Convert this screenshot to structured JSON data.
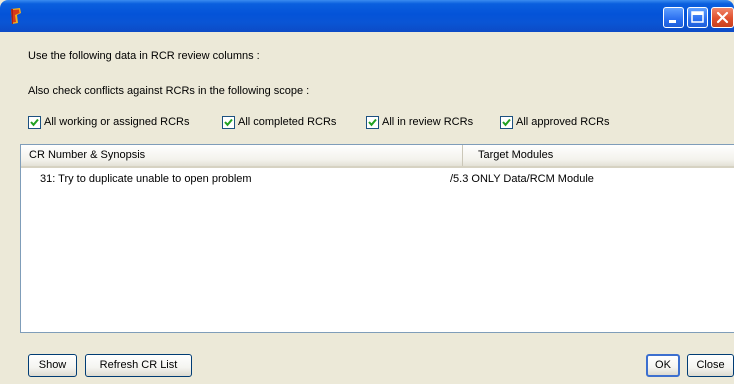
{
  "window": {
    "title": ""
  },
  "labels": {
    "review_columns": "Use the following data in RCR review columns :",
    "conflict_scope": "Also check conflicts against RCRs in the following scope :"
  },
  "scope_checks": [
    {
      "label": "All working or assigned RCRs",
      "checked": true
    },
    {
      "label": "All completed RCRs",
      "checked": true
    },
    {
      "label": "All in review RCRs",
      "checked": true
    },
    {
      "label": "All approved RCRs",
      "checked": true
    }
  ],
  "list": {
    "columns": [
      "CR Number & Synopsis",
      "Target Modules"
    ],
    "rows": [
      [
        "31: Try to duplicate unable to open problem",
        "/5.3 ONLY Data/RCM Module"
      ]
    ]
  },
  "buttons": {
    "show": "Show",
    "refresh": "Refresh CR List",
    "ok": "OK",
    "close": "Close"
  },
  "icons": {
    "app": "app-icon",
    "minimize": "minimize-icon",
    "maximize": "maximize-icon",
    "close": "close-icon",
    "check": "checkmark-icon"
  },
  "colors": {
    "titlebar": "#0453d8",
    "dialog_bg": "#ece9d8",
    "close_button": "#e0502d"
  }
}
